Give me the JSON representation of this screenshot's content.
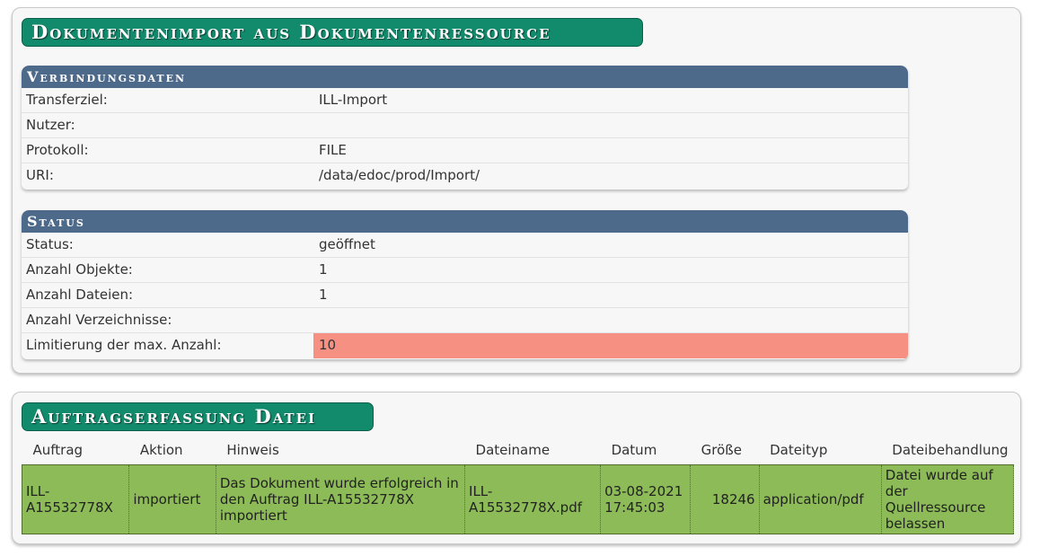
{
  "import_panel": {
    "title": "Dokumentenimport aus Dokumentenressource",
    "verbindung": {
      "heading": "Verbindungsdaten",
      "rows": [
        {
          "label": "Transferziel:",
          "value": "ILL-Import"
        },
        {
          "label": "Nutzer:",
          "value": ""
        },
        {
          "label": "Protokoll:",
          "value": "FILE"
        },
        {
          "label": "URI:",
          "value": "/data/edoc/prod/Import/"
        }
      ]
    },
    "status": {
      "heading": "Status",
      "rows": [
        {
          "label": "Status:",
          "value": "geöffnet"
        },
        {
          "label": "Anzahl Objekte:",
          "value": "1"
        },
        {
          "label": "Anzahl Dateien:",
          "value": "1"
        },
        {
          "label": "Anzahl Verzeichnisse:",
          "value": ""
        },
        {
          "label": "Limitierung der max. Anzahl:",
          "value": "10"
        }
      ],
      "warn_color": "#f59083"
    }
  },
  "auftrag_panel": {
    "title": "Auftragserfassung Datei",
    "columns": [
      "Auftrag",
      "Aktion",
      "Hinweis",
      "Dateiname",
      "Datum",
      "Größe",
      "Dateityp",
      "Dateibehandlung"
    ],
    "rows": [
      {
        "auftrag": "ILL-A15532778X",
        "aktion": "importiert",
        "hinweis": "Das Dokument wurde erfolgreich in den Auftrag ILL-A15532778X importiert",
        "dateiname": "ILL-A15532778X.pdf",
        "datum": "03-08-2021 17:45:03",
        "groesse": "18246",
        "dateityp": "application/pdf",
        "dateibehandlung": "Datei wurde auf der Quellressource belassen"
      }
    ],
    "row_color": "#8cbb57"
  },
  "colors": {
    "title_bg": "#128a6c",
    "section_head_bg": "#4e6a8a"
  }
}
